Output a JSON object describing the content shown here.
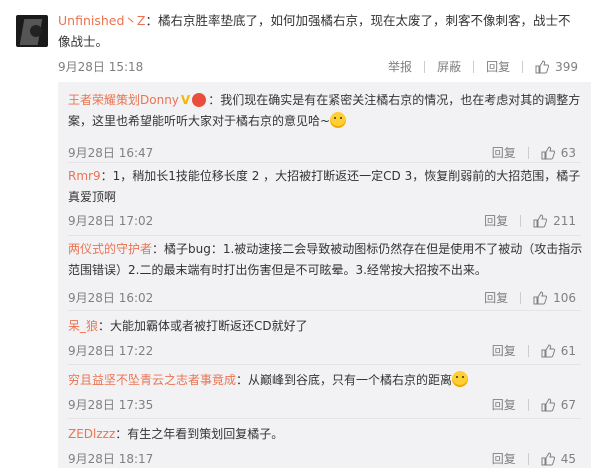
{
  "main_comment": {
    "username": "Unfinished丶Z",
    "text": "：橘右京胜率垫底了，如何加强橘右京，现在太废了，刺客不像刺客，战士不像战士。",
    "date": "9月28日 15:18",
    "report": "举报",
    "block": "屏蔽",
    "reply": "回复",
    "likes": "399"
  },
  "replies": [
    {
      "username": "王者荣耀策划Donny",
      "text": "：我们现在确实是有在紧密关注橘右京的情况，也在考虑对其的调整方案，这里也希望能听听大家对于橘右京的意见哈~",
      "date": "9月28日 16:47",
      "reply": "回复",
      "likes": "63"
    },
    {
      "username": "Rmr9",
      "text": "：1，稍加长1技能位移长度 2 ，大招被打断返还一定CD 3，恢复削弱前的大招范围，橘子真爱顶啊",
      "date": "9月28日 17:02",
      "reply": "回复",
      "likes": "211"
    },
    {
      "username": "两仪式的守护者",
      "text": "：橘子bug：1.被动速接二会导致被动图标仍然存在但是使用不了被动（攻击指示范围错误）2.二的最末端有时打出伤害但是不可眩晕。3.经常按大招按不出来。",
      "date": "9月28日 16:02",
      "reply": "回复",
      "likes": "106"
    },
    {
      "username": "呆_狼",
      "text": "：大能加霸体或者被打断返还CD就好了",
      "date": "9月28日 17:22",
      "reply": "回复",
      "likes": "61"
    },
    {
      "username": "穷且益坚不坠青云之志者事竟成",
      "text": "：从巅峰到谷底，只有一个橘右京的距离",
      "date": "9月28日 17:35",
      "reply": "回复",
      "likes": "67"
    },
    {
      "username": "ZEDlzzz",
      "text": "：有生之年看到策划回复橘子。",
      "date": "9月28日 18:17",
      "reply": "回复",
      "likes": "45"
    }
  ],
  "colors": {
    "username": "#eb7350",
    "meta": "#808080",
    "reply_bg": "#f2f2f5"
  },
  "icons": {
    "like": "thumbs-up-icon",
    "verified": "v-badge-icon",
    "emoji": "emoji-icon"
  }
}
